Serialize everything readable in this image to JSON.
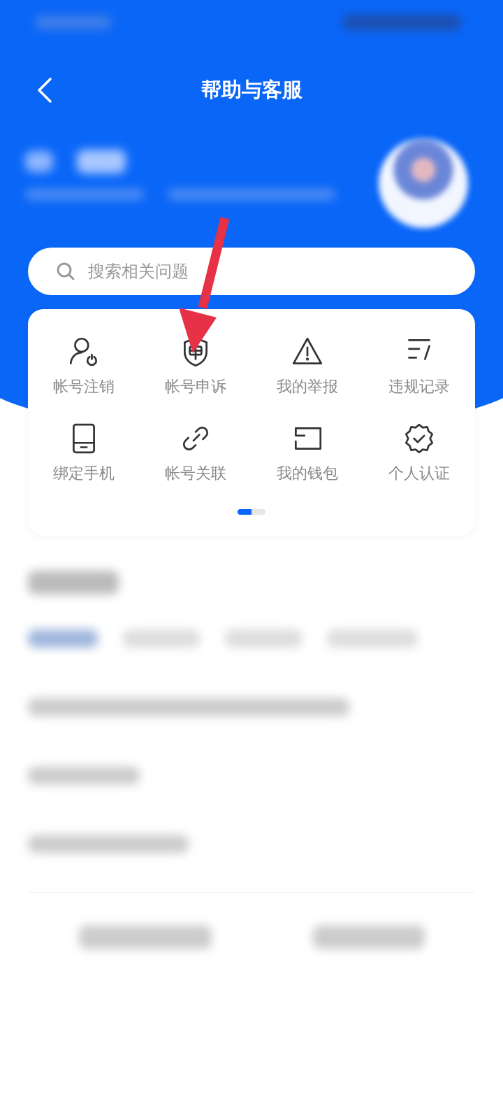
{
  "header": {
    "title": "帮助与客服"
  },
  "search": {
    "placeholder": "搜索相关问题"
  },
  "shortcuts": [
    {
      "label": "帐号注销"
    },
    {
      "label": "帐号申诉"
    },
    {
      "label": "我的举报"
    },
    {
      "label": "违规记录"
    },
    {
      "label": "绑定手机"
    },
    {
      "label": "帐号关联"
    },
    {
      "label": "我的钱包"
    },
    {
      "label": "个人认证"
    }
  ],
  "pager": [
    {
      "selected": true
    },
    {
      "selected": false
    }
  ]
}
